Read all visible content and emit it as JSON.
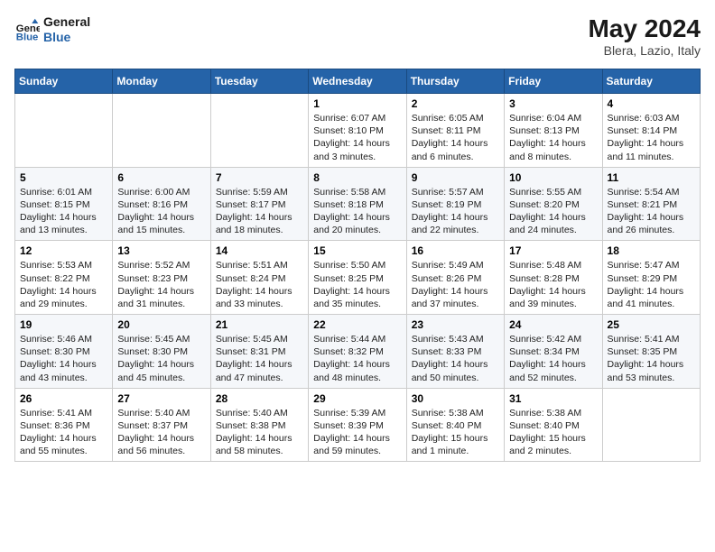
{
  "header": {
    "logo_line1": "General",
    "logo_line2": "Blue",
    "month_year": "May 2024",
    "location": "Blera, Lazio, Italy"
  },
  "weekdays": [
    "Sunday",
    "Monday",
    "Tuesday",
    "Wednesday",
    "Thursday",
    "Friday",
    "Saturday"
  ],
  "weeks": [
    [
      {
        "day": "",
        "info": ""
      },
      {
        "day": "",
        "info": ""
      },
      {
        "day": "",
        "info": ""
      },
      {
        "day": "1",
        "info": "Sunrise: 6:07 AM\nSunset: 8:10 PM\nDaylight: 14 hours\nand 3 minutes."
      },
      {
        "day": "2",
        "info": "Sunrise: 6:05 AM\nSunset: 8:11 PM\nDaylight: 14 hours\nand 6 minutes."
      },
      {
        "day": "3",
        "info": "Sunrise: 6:04 AM\nSunset: 8:13 PM\nDaylight: 14 hours\nand 8 minutes."
      },
      {
        "day": "4",
        "info": "Sunrise: 6:03 AM\nSunset: 8:14 PM\nDaylight: 14 hours\nand 11 minutes."
      }
    ],
    [
      {
        "day": "5",
        "info": "Sunrise: 6:01 AM\nSunset: 8:15 PM\nDaylight: 14 hours\nand 13 minutes."
      },
      {
        "day": "6",
        "info": "Sunrise: 6:00 AM\nSunset: 8:16 PM\nDaylight: 14 hours\nand 15 minutes."
      },
      {
        "day": "7",
        "info": "Sunrise: 5:59 AM\nSunset: 8:17 PM\nDaylight: 14 hours\nand 18 minutes."
      },
      {
        "day": "8",
        "info": "Sunrise: 5:58 AM\nSunset: 8:18 PM\nDaylight: 14 hours\nand 20 minutes."
      },
      {
        "day": "9",
        "info": "Sunrise: 5:57 AM\nSunset: 8:19 PM\nDaylight: 14 hours\nand 22 minutes."
      },
      {
        "day": "10",
        "info": "Sunrise: 5:55 AM\nSunset: 8:20 PM\nDaylight: 14 hours\nand 24 minutes."
      },
      {
        "day": "11",
        "info": "Sunrise: 5:54 AM\nSunset: 8:21 PM\nDaylight: 14 hours\nand 26 minutes."
      }
    ],
    [
      {
        "day": "12",
        "info": "Sunrise: 5:53 AM\nSunset: 8:22 PM\nDaylight: 14 hours\nand 29 minutes."
      },
      {
        "day": "13",
        "info": "Sunrise: 5:52 AM\nSunset: 8:23 PM\nDaylight: 14 hours\nand 31 minutes."
      },
      {
        "day": "14",
        "info": "Sunrise: 5:51 AM\nSunset: 8:24 PM\nDaylight: 14 hours\nand 33 minutes."
      },
      {
        "day": "15",
        "info": "Sunrise: 5:50 AM\nSunset: 8:25 PM\nDaylight: 14 hours\nand 35 minutes."
      },
      {
        "day": "16",
        "info": "Sunrise: 5:49 AM\nSunset: 8:26 PM\nDaylight: 14 hours\nand 37 minutes."
      },
      {
        "day": "17",
        "info": "Sunrise: 5:48 AM\nSunset: 8:28 PM\nDaylight: 14 hours\nand 39 minutes."
      },
      {
        "day": "18",
        "info": "Sunrise: 5:47 AM\nSunset: 8:29 PM\nDaylight: 14 hours\nand 41 minutes."
      }
    ],
    [
      {
        "day": "19",
        "info": "Sunrise: 5:46 AM\nSunset: 8:30 PM\nDaylight: 14 hours\nand 43 minutes."
      },
      {
        "day": "20",
        "info": "Sunrise: 5:45 AM\nSunset: 8:30 PM\nDaylight: 14 hours\nand 45 minutes."
      },
      {
        "day": "21",
        "info": "Sunrise: 5:45 AM\nSunset: 8:31 PM\nDaylight: 14 hours\nand 47 minutes."
      },
      {
        "day": "22",
        "info": "Sunrise: 5:44 AM\nSunset: 8:32 PM\nDaylight: 14 hours\nand 48 minutes."
      },
      {
        "day": "23",
        "info": "Sunrise: 5:43 AM\nSunset: 8:33 PM\nDaylight: 14 hours\nand 50 minutes."
      },
      {
        "day": "24",
        "info": "Sunrise: 5:42 AM\nSunset: 8:34 PM\nDaylight: 14 hours\nand 52 minutes."
      },
      {
        "day": "25",
        "info": "Sunrise: 5:41 AM\nSunset: 8:35 PM\nDaylight: 14 hours\nand 53 minutes."
      }
    ],
    [
      {
        "day": "26",
        "info": "Sunrise: 5:41 AM\nSunset: 8:36 PM\nDaylight: 14 hours\nand 55 minutes."
      },
      {
        "day": "27",
        "info": "Sunrise: 5:40 AM\nSunset: 8:37 PM\nDaylight: 14 hours\nand 56 minutes."
      },
      {
        "day": "28",
        "info": "Sunrise: 5:40 AM\nSunset: 8:38 PM\nDaylight: 14 hours\nand 58 minutes."
      },
      {
        "day": "29",
        "info": "Sunrise: 5:39 AM\nSunset: 8:39 PM\nDaylight: 14 hours\nand 59 minutes."
      },
      {
        "day": "30",
        "info": "Sunrise: 5:38 AM\nSunset: 8:40 PM\nDaylight: 15 hours\nand 1 minute."
      },
      {
        "day": "31",
        "info": "Sunrise: 5:38 AM\nSunset: 8:40 PM\nDaylight: 15 hours\nand 2 minutes."
      },
      {
        "day": "",
        "info": ""
      }
    ]
  ]
}
